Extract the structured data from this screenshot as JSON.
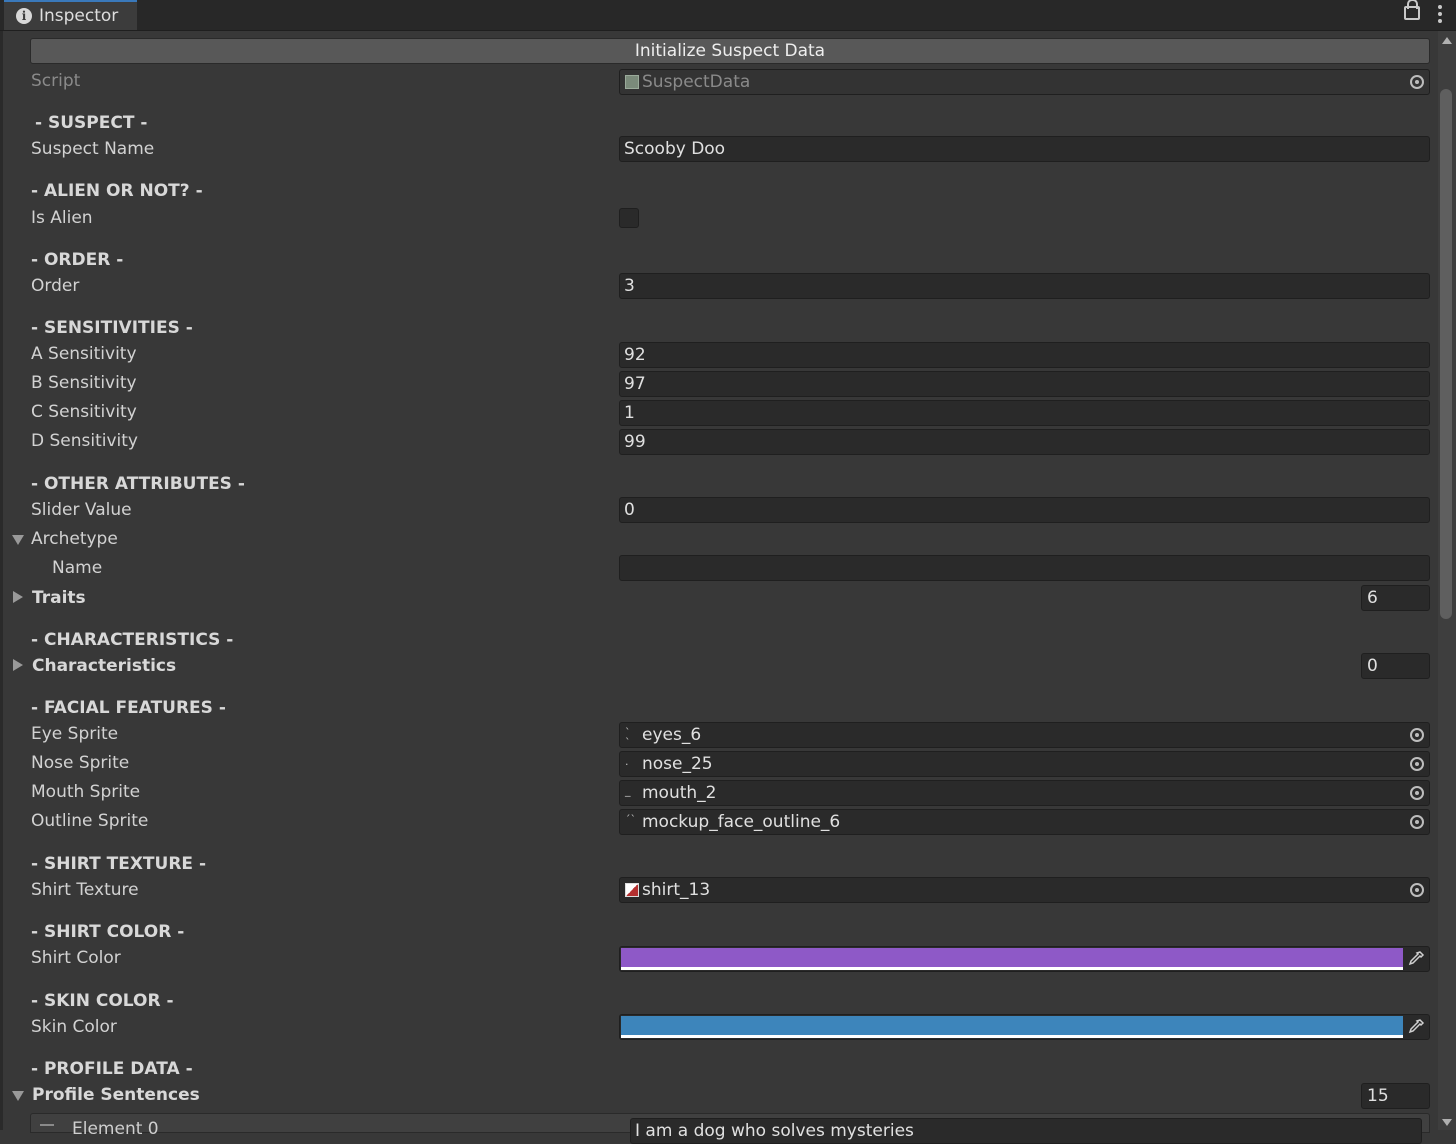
{
  "tab": {
    "title": "Inspector",
    "icon": "info-icon"
  },
  "toolbar": {
    "lock_icon": "lock-icon",
    "menu_icon": "kebab-menu-icon"
  },
  "init_button": "Initialize Suspect Data",
  "script": {
    "label": "Script",
    "value": "SuspectData"
  },
  "sections": {
    "suspect": "- SUSPECT -",
    "alien": "- ALIEN OR NOT? -",
    "order": "- ORDER -",
    "sensitivities": "- SENSITIVITIES -",
    "other": "- OTHER ATTRIBUTES -",
    "characteristics": "- CHARACTERISTICS -",
    "facial": "- FACIAL FEATURES -",
    "shirt_texture": "- SHIRT TEXTURE -",
    "shirt_color": "- SHIRT COLOR -",
    "skin_color": "- SKIN COLOR -",
    "profile": "- PROFILE DATA -"
  },
  "fields": {
    "suspect_name": {
      "label": "Suspect Name",
      "value": "Scooby Doo"
    },
    "is_alien": {
      "label": "Is Alien",
      "checked": false
    },
    "order": {
      "label": "Order",
      "value": "3"
    },
    "a_sens": {
      "label": "A Sensitivity",
      "value": "92"
    },
    "b_sens": {
      "label": "B Sensitivity",
      "value": "97"
    },
    "c_sens": {
      "label": "C Sensitivity",
      "value": "1"
    },
    "d_sens": {
      "label": "D Sensitivity",
      "value": "99"
    },
    "slider_value": {
      "label": "Slider Value",
      "value": "0"
    },
    "archetype": {
      "label": "Archetype",
      "expanded": true
    },
    "archetype_name": {
      "label": "Name",
      "value": ""
    },
    "traits": {
      "label": "Traits",
      "count": "6"
    },
    "characteristics": {
      "label": "Characteristics",
      "count": "0"
    },
    "eye_sprite": {
      "label": "Eye Sprite",
      "value": "eyes_6"
    },
    "nose_sprite": {
      "label": "Nose Sprite",
      "value": "nose_25"
    },
    "mouth_sprite": {
      "label": "Mouth Sprite",
      "value": "mouth_2"
    },
    "outline_sprite": {
      "label": "Outline Sprite",
      "value": "mockup_face_outline_6"
    },
    "shirt_texture": {
      "label": "Shirt Texture",
      "value": "shirt_13"
    },
    "shirt_color": {
      "label": "Shirt Color",
      "color": "#8e59c7"
    },
    "skin_color": {
      "label": "Skin Color",
      "color": "#3d85bb"
    },
    "profile_sentences": {
      "label": "Profile Sentences",
      "count": "15"
    },
    "element_0": {
      "label": "Element 0",
      "value": "I am a dog who solves mysteries"
    }
  },
  "colors": {
    "panel_bg": "#383838",
    "field_bg": "#2a2a2a",
    "accent": "#3a79bb"
  }
}
